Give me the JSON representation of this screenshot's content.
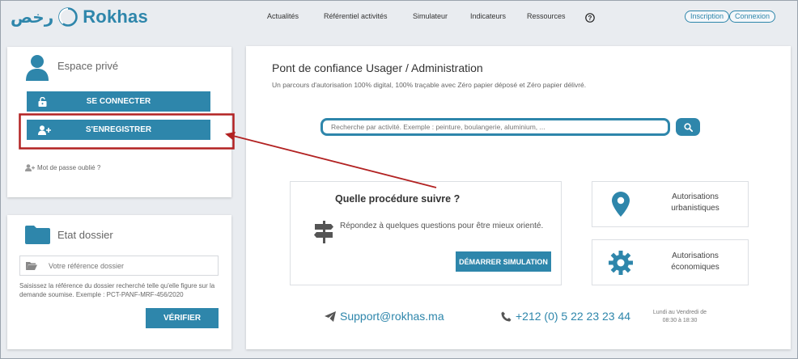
{
  "brand": {
    "arabic": "رخص",
    "name": "Rokhas",
    "color": "#2e86ab"
  },
  "nav": {
    "items": [
      "Actualités",
      "Référentiel activités",
      "Simulateur",
      "Indicateurs",
      "Ressources"
    ]
  },
  "auth": {
    "signup": "Inscription",
    "login": "Connexion"
  },
  "espace": {
    "title": "Espace privé",
    "connect": "SE CONNECTER",
    "register": "S'ENREGISTRER",
    "forgot": "Mot de passe oublié ?"
  },
  "dossier": {
    "title": "Etat dossier",
    "placeholder": "Votre référence dossier",
    "help": "Saisissez la référence du dossier recherché telle qu'elle figure sur la demande soumise. Exemple : PCT-PANF-MRF-456/2020",
    "verify": "VÉRIFIER"
  },
  "main": {
    "title": "Pont de confiance Usager / Administration",
    "subtitle": "Un parcours d'autorisation 100% digital, 100% traçable avec Zéro papier déposé et Zéro papier délivré.",
    "search_placeholder": "Recherche par activité. Exemple : peinture, boulangerie, aluminium, ...",
    "procedure_title": "Quelle procédure suivre ?",
    "procedure_text": "Répondez à quelques questions pour être mieux orienté.",
    "simulation_btn": "DÉMARRER SIMULATION",
    "tile1": "Autorisations urbanistiques",
    "tile2": "Autorisations économiques",
    "support_email": "Support@rokhas.ma",
    "phone": "+212 (0) 5 22 23 23 44",
    "hours_1": "Lundi au Vendredi de",
    "hours_2": "08:30 à 18:30"
  },
  "annotation": {
    "highlight_color": "#b22222"
  }
}
